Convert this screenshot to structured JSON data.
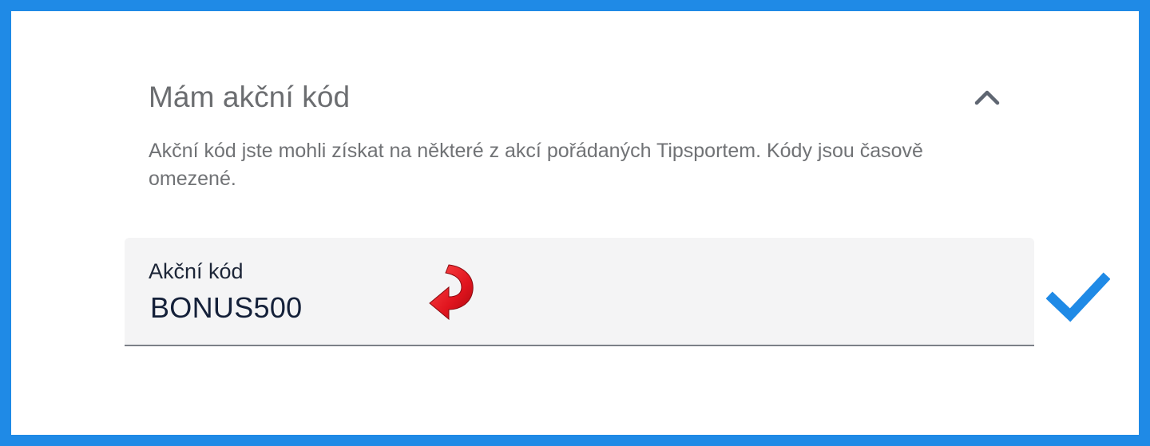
{
  "promo_section": {
    "title": "Mám akční kód",
    "description": "Akční kód jste mohli získat na některé z akcí pořádaných Tipsportem. Kódy jsou časově omezené.",
    "toggle_icon": "chevron-up-icon"
  },
  "promo_field": {
    "label": "Akční kód",
    "value": "BONUS500",
    "annotation_icon": "curved-arrow-icon"
  },
  "confirm": {
    "icon": "checkmark-icon",
    "color": "#1f8ae6"
  },
  "colors": {
    "frame_border": "#1f8ae6",
    "arrow_red": "#e0141e",
    "field_background": "#f4f4f5"
  }
}
